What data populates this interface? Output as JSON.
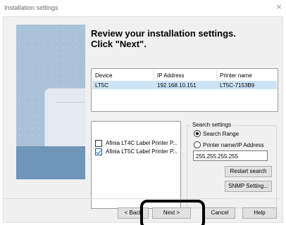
{
  "window": {
    "title": "Installation settings",
    "close_glyph": "×"
  },
  "heading": {
    "line1": "Review your installation settings.",
    "line2": "Click \"Next\"."
  },
  "table": {
    "columns": [
      "Device",
      "IP Address",
      "Printer name"
    ],
    "rows": [
      {
        "device": "LT5C",
        "ip": "192.168.10.151",
        "name": "LT5C-7153B9"
      }
    ]
  },
  "printers": [
    {
      "label": "Afinia LT4C Label Printer P...",
      "checked": false
    },
    {
      "label": "Afinia LT5C Label Printer P...",
      "checked": true
    }
  ],
  "search": {
    "legend": "Search settings",
    "range_label": "Search Range",
    "ip_label": "Printer name/IP Address",
    "ip_value": "255.255.255.255",
    "restart_label": "Restart search",
    "snmp_label": "SNMP Setting..."
  },
  "footer": {
    "back": "< Back",
    "next": "Next >",
    "cancel": "Cancel",
    "help": "Help"
  },
  "icons": {
    "close": "close-icon",
    "check": "checkmark-icon"
  },
  "colors": {
    "selection": "#cde4f7",
    "banner_dark": "#6f95b8",
    "banner_light": "#a9c2d8"
  }
}
